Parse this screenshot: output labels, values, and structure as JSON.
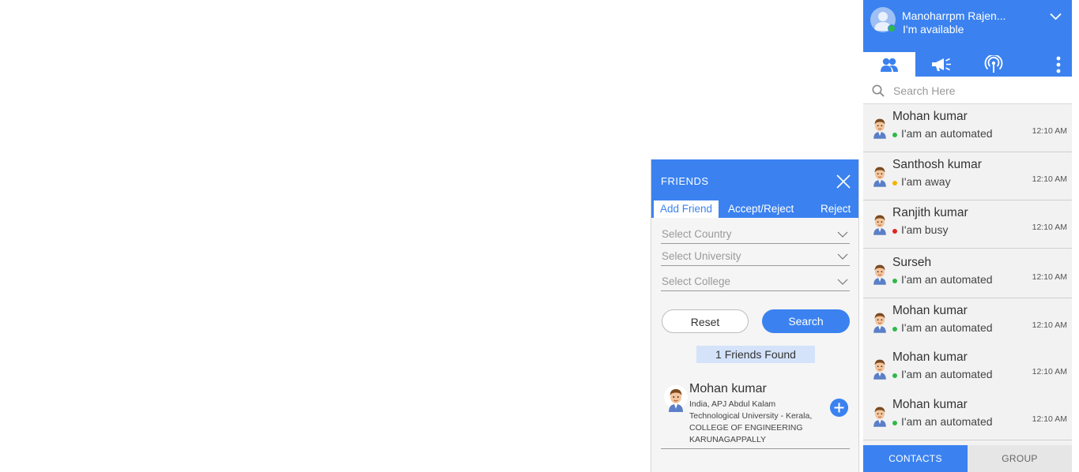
{
  "friends_panel": {
    "title": "FRIENDS",
    "tabs": [
      "Add Friend",
      "Accept/Reject",
      "Reject"
    ],
    "selects": [
      {
        "placeholder": "Select Country"
      },
      {
        "placeholder": "Select University"
      },
      {
        "placeholder": "Select College"
      }
    ],
    "reset_label": "Reset",
    "search_label": "Search",
    "found_text": "1 Friends Found",
    "result": {
      "name": "Mohan kumar",
      "details": "India, APJ Abdul Kalam Technological University - Kerala, COLLEGE OF ENGINEERING KARUNAGAPPALLY"
    }
  },
  "sidebar": {
    "user_name": "Manoharrpm Rajen...",
    "user_status": "I'm available",
    "search_placeholder": "Search Here",
    "contacts": [
      {
        "name": "Mohan kumar",
        "status": "I'am an automated",
        "time": "12:10 AM",
        "status_color": "#2fb84a"
      },
      {
        "name": "Santhosh kumar",
        "status": "I'am away",
        "time": "12:10 AM",
        "status_color": "#f4b400"
      },
      {
        "name": "Ranjith kumar",
        "status": "I'am busy",
        "time": "12:10 AM",
        "status_color": "#e02424"
      },
      {
        "name": "Surseh",
        "status": "I'am an automated",
        "time": "12:10 AM",
        "status_color": "#2fb84a"
      },
      {
        "name": "Mohan kumar",
        "status": "I'am an automated",
        "time": "12:10 AM",
        "status_color": "#2fb84a"
      },
      {
        "name": "Mohan kumar",
        "status": "I'am an automated",
        "time": "12:10 AM",
        "status_color": "#2fb84a"
      },
      {
        "name": "Mohan kumar",
        "status": "I'am an automated",
        "time": "12:10 AM",
        "status_color": "#2fb84a"
      }
    ],
    "footer": {
      "contacts_label": "CONTACTS",
      "group_label": "GROUP"
    }
  },
  "colors": {
    "accent": "#3b82f0"
  }
}
